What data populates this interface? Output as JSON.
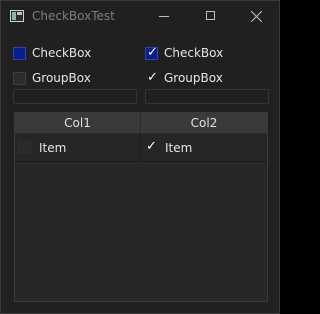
{
  "window": {
    "title": "CheckBoxTest"
  },
  "checkboxes": {
    "left_top": {
      "label": "CheckBox",
      "checked": false
    },
    "right_top": {
      "label": "CheckBox",
      "checked": true
    },
    "left_group": {
      "label": "GroupBox",
      "checked": false
    },
    "right_group": {
      "label": "GroupBox",
      "checked": true
    }
  },
  "table": {
    "columns": [
      "Col1",
      "Col2"
    ],
    "rows": [
      {
        "c1": {
          "label": "Item",
          "checked": false
        },
        "c2": {
          "label": "Item",
          "checked": true
        }
      }
    ]
  }
}
